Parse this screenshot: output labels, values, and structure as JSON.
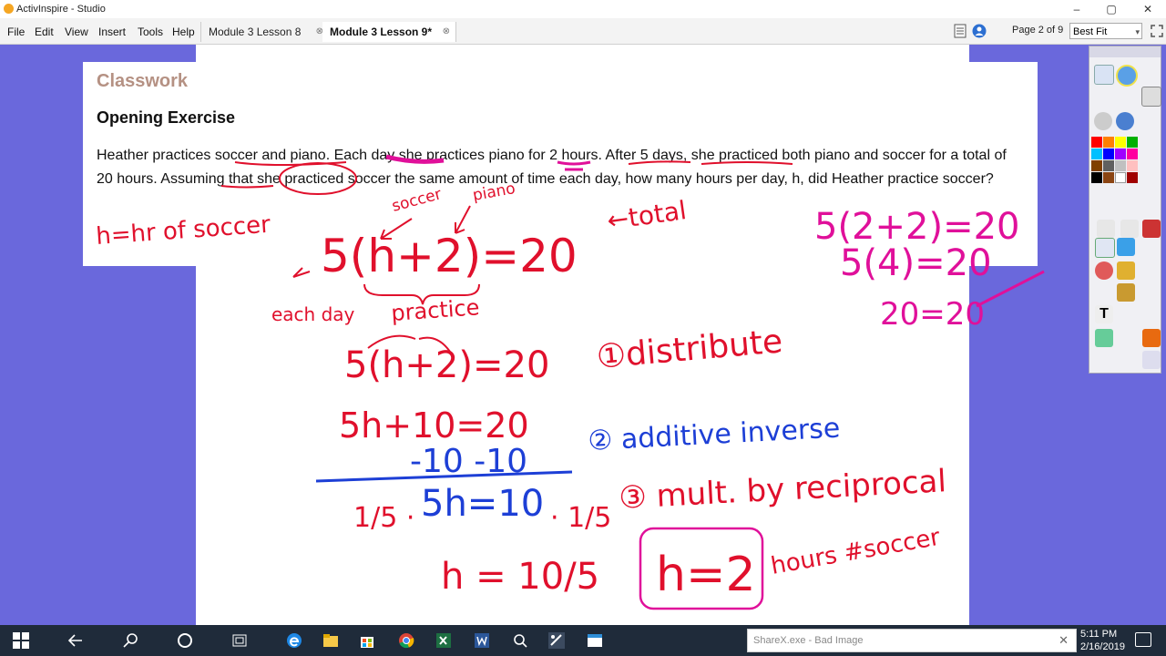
{
  "window": {
    "title": "ActivInspire - Studio",
    "min_glyph": "–",
    "max_glyph": "▢",
    "close_glyph": "✕"
  },
  "menu": [
    "File",
    "Edit",
    "View",
    "Insert",
    "Tools",
    "Help"
  ],
  "tabs": [
    {
      "label": "Module 3 Lesson 8",
      "active": false
    },
    {
      "label": "Module 3 Lesson 9*",
      "active": true
    }
  ],
  "tab_close_glyph": "⊗",
  "page_indicator": "Page 2 of 9",
  "zoom": "Best Fit",
  "slide": {
    "heading": "Classwork",
    "subheading": "Opening Exercise",
    "body": "Heather practices soccer and piano.  Each day she practices piano for 2 hours.  After 5 days, she practiced both piano and soccer for a total of 20 hours.  Assuming that she practiced soccer the same amount of time each day, how many hours per day, h, did Heather practice soccer?"
  },
  "annotations": {
    "h_def": "h=hr of soccer",
    "soccer": "soccer",
    "piano": "piano",
    "eq1": "5(h+2)=20",
    "total": "←total",
    "each_day": "each day",
    "practice": "practice",
    "eq2": "5(h+2)=20",
    "step1": "①distribute",
    "eq3": "5h+10=20",
    "eq4": "-10 -10",
    "step2": "② additive inverse",
    "step3": "③ mult. by reciprocal",
    "eq5_left": "1/5 ·",
    "eq5": "5h=10",
    "eq5_right": "· 1/5",
    "eq6": "h = 10/5",
    "answer": "h=2",
    "answer_unit": "hours #soccer",
    "check1": "5(2+2)=20",
    "check2": "5(4)=20",
    "check3": "20=20"
  },
  "colors": {
    "ink_red": "#e0102c",
    "ink_magenta": "#e0109a",
    "ink_blue": "#1d3fd6",
    "bg": "#6a68dc",
    "heading": "#b59183"
  },
  "taskbar": {
    "icons": [
      "windows-start-icon",
      "back-icon",
      "search-icon",
      "cortana-icon",
      "task-view-icon",
      "edge-icon",
      "file-explorer-icon",
      "store-icon",
      "chrome-icon",
      "excel-icon",
      "word-icon",
      "search-app-icon",
      "activinspire-icon",
      "window-app-icon"
    ],
    "notification": "ShareX.exe - Bad Image",
    "time": "5:11 PM",
    "date": "2/16/2019"
  }
}
